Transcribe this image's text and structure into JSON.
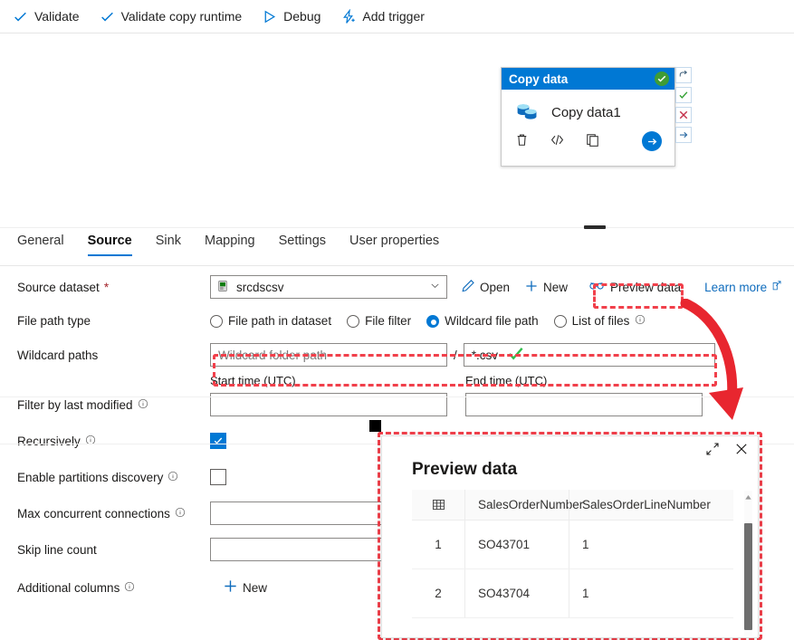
{
  "toolbar": {
    "items": [
      {
        "label": "Validate",
        "icon": "check-icon"
      },
      {
        "label": "Validate copy runtime",
        "icon": "check-icon"
      },
      {
        "label": "Debug",
        "icon": "play-icon"
      },
      {
        "label": "Add trigger",
        "icon": "lightning-plus-icon"
      }
    ]
  },
  "canvas": {
    "activity": {
      "header_title": "Copy data",
      "status": "succeeded",
      "name": "Copy data1",
      "footer_icons": [
        "delete-icon",
        "code-icon",
        "duplicate-icon",
        "run-icon"
      ]
    },
    "connector_icons": [
      "retry-icon",
      "on-success-icon",
      "on-failure-icon",
      "on-completion-icon"
    ]
  },
  "tabs": [
    {
      "label": "General",
      "active": false
    },
    {
      "label": "Source",
      "active": true
    },
    {
      "label": "Sink",
      "active": false
    },
    {
      "label": "Mapping",
      "active": false
    },
    {
      "label": "Settings",
      "active": false
    },
    {
      "label": "User properties",
      "active": false
    }
  ],
  "form": {
    "source_dataset": {
      "label": "Source dataset",
      "required_marker": "*",
      "value": "srcdscsv",
      "actions": [
        {
          "label": "Open",
          "icon": "pencil-icon"
        },
        {
          "label": "New",
          "icon": "plus-icon"
        },
        {
          "label": "Preview data",
          "icon": "preview-icon"
        }
      ],
      "learn_more": "Learn more"
    },
    "file_path_type": {
      "label": "File path type",
      "options": [
        {
          "label": "File path in dataset",
          "selected": false,
          "info": false
        },
        {
          "label": "File filter",
          "selected": false,
          "info": false
        },
        {
          "label": "Wildcard file path",
          "selected": true,
          "info": false
        },
        {
          "label": "List of files",
          "selected": false,
          "info": true
        }
      ]
    },
    "wildcard_paths": {
      "label": "Wildcard paths",
      "folder_placeholder": "Wildcard folder path",
      "folder_value": "",
      "separator": "/",
      "file_value": "*.csv",
      "validated": true
    },
    "filter_by_last_modified": {
      "label": "Filter by last modified",
      "start_label": "Start time (UTC)",
      "end_label": "End time (UTC)",
      "start_value": "",
      "end_value": ""
    },
    "recursively": {
      "label": "Recursively",
      "checked": true
    },
    "enable_partitions_discovery": {
      "label": "Enable partitions discovery",
      "checked": false
    },
    "max_concurrent_connections": {
      "label": "Max concurrent connections",
      "value": ""
    },
    "skip_line_count": {
      "label": "Skip line count",
      "value": ""
    },
    "additional_columns": {
      "label": "Additional columns",
      "new_label": "New"
    }
  },
  "preview_panel": {
    "title": "Preview data",
    "expand_icon": "expand-icon",
    "close_icon": "close-icon",
    "columns": [
      "",
      "SalesOrderNumber",
      "SalesOrderLineNumber"
    ],
    "rows": [
      {
        "index": "1",
        "SalesOrderNumber": "SO43701",
        "SalesOrderLineNumber": "1"
      },
      {
        "index": "2",
        "SalesOrderNumber": "SO43704",
        "SalesOrderLineNumber": "1"
      }
    ]
  },
  "annotations": {
    "highlight_color": "#f1404b",
    "arrow": "curved-arrow-down"
  },
  "colors": {
    "accent": "#0078d4",
    "link": "#0f6cbd",
    "success": "#3f9c35",
    "error": "#c4314b",
    "highlight": "#f1404b"
  }
}
